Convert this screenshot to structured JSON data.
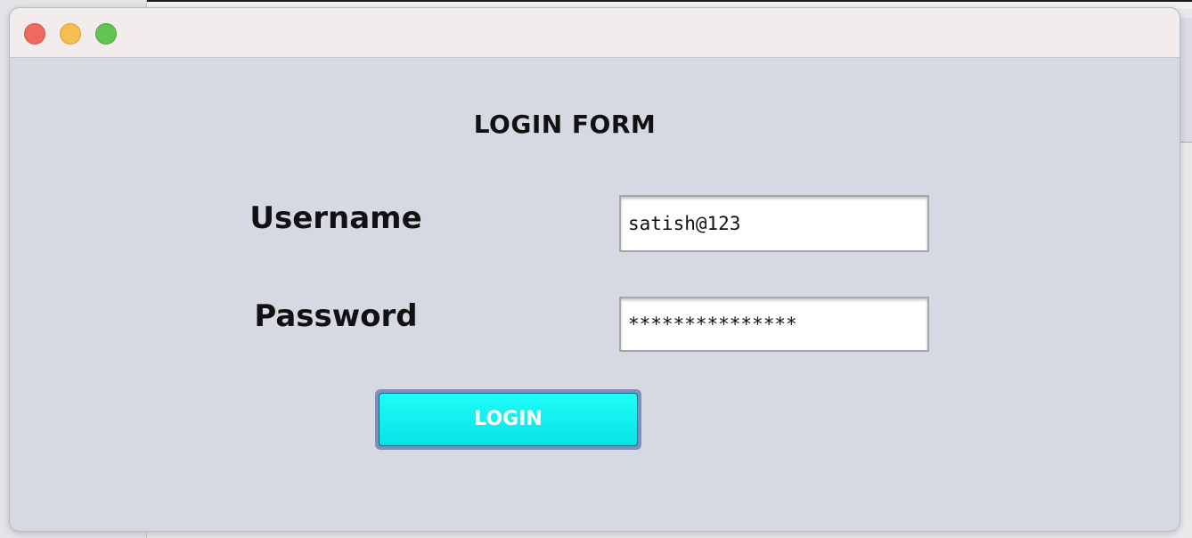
{
  "window": {
    "form_title": "LOGIN FORM"
  },
  "form": {
    "username_label": "Username",
    "username_value": "satish@123",
    "password_label": "Password",
    "password_value": "***************",
    "login_label": "LOGIN"
  },
  "colors": {
    "button_fill": "#12f0f0",
    "window_bg": "#d6d9e1",
    "titlebar_bg": "#f2eced"
  },
  "icons": [
    "close-traffic-light",
    "minimize-traffic-light",
    "maximize-traffic-light"
  ]
}
